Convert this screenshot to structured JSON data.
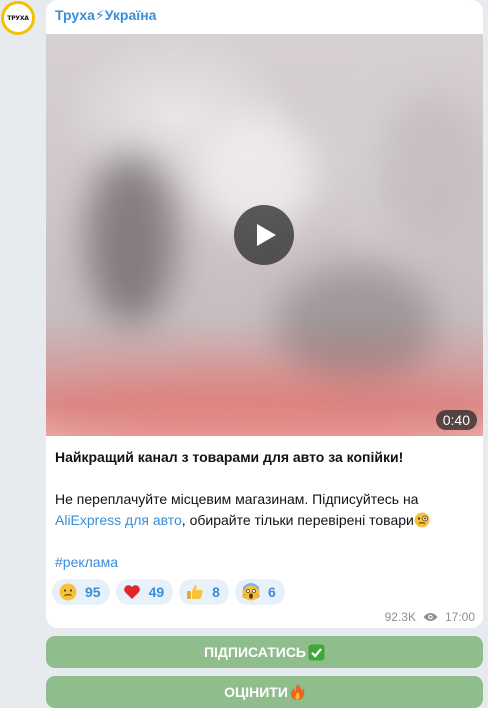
{
  "channel": {
    "name": "Труха⚡Україна",
    "avatar_text": "ТРУХА"
  },
  "video": {
    "duration": "0:40"
  },
  "post": {
    "headline": "Найкращий канал з товарами для авто за копійки!",
    "body_prefix": "Не переплачуйте місцевим магазинам. Підписуйтесь на ",
    "link_text": "AliExpress для авто",
    "body_suffix": ", обирайте тільки перевірені товари",
    "hashtag": "#реклама"
  },
  "reactions": [
    {
      "icon": "confused-face-icon",
      "count": "95"
    },
    {
      "icon": "red-heart-icon",
      "count": "49"
    },
    {
      "icon": "thumbs-up-icon",
      "count": "8"
    },
    {
      "icon": "screaming-face-icon",
      "count": "6"
    }
  ],
  "meta": {
    "views": "92.3K",
    "time": "17:00"
  },
  "buttons": {
    "subscribe": "ПІДПИСАТИСЬ",
    "rate": "ОЦІНИТИ"
  },
  "colors": {
    "accent": "#3a8ed6",
    "button_bg": "#8fbd8b",
    "chat_bg": "#e7ebf0"
  }
}
